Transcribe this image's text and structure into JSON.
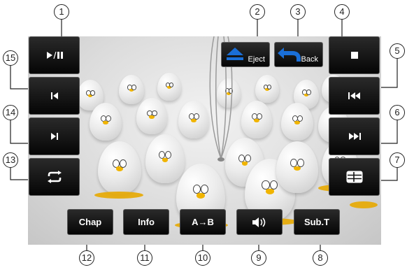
{
  "side_left": [
    {
      "id": "play_pause",
      "icon": "play-pause-icon"
    },
    {
      "id": "prev_chapter",
      "icon": "skip-to-start-icon"
    },
    {
      "id": "next_chapter",
      "icon": "skip-to-end-icon"
    },
    {
      "id": "repeat",
      "icon": "repeat-icon"
    }
  ],
  "side_right": [
    {
      "id": "stop",
      "icon": "stop-icon"
    },
    {
      "id": "rewind",
      "icon": "fast-rewind-icon"
    },
    {
      "id": "fast_forward",
      "icon": "fast-forward-icon"
    },
    {
      "id": "menu",
      "icon": "menu-list-icon"
    }
  ],
  "top": {
    "eject_label": "Eject",
    "back_label": "Back"
  },
  "bottom": {
    "chap": "Chap",
    "info": "Info",
    "ab": "A→B",
    "volume_icon": "speaker-icon",
    "subt": "Sub.T"
  },
  "callouts": {
    "c1": "1",
    "c2": "2",
    "c3": "3",
    "c4": "4",
    "c5": "5",
    "c6": "6",
    "c7": "7",
    "c8": "8",
    "c9": "9",
    "c10": "10",
    "c11": "11",
    "c12": "12",
    "c13": "13",
    "c14": "14",
    "c15": "15"
  },
  "colors": {
    "button_bg": "#111111",
    "eject_blue": "#1a6fd8",
    "egg_beak": "#f0b400"
  }
}
